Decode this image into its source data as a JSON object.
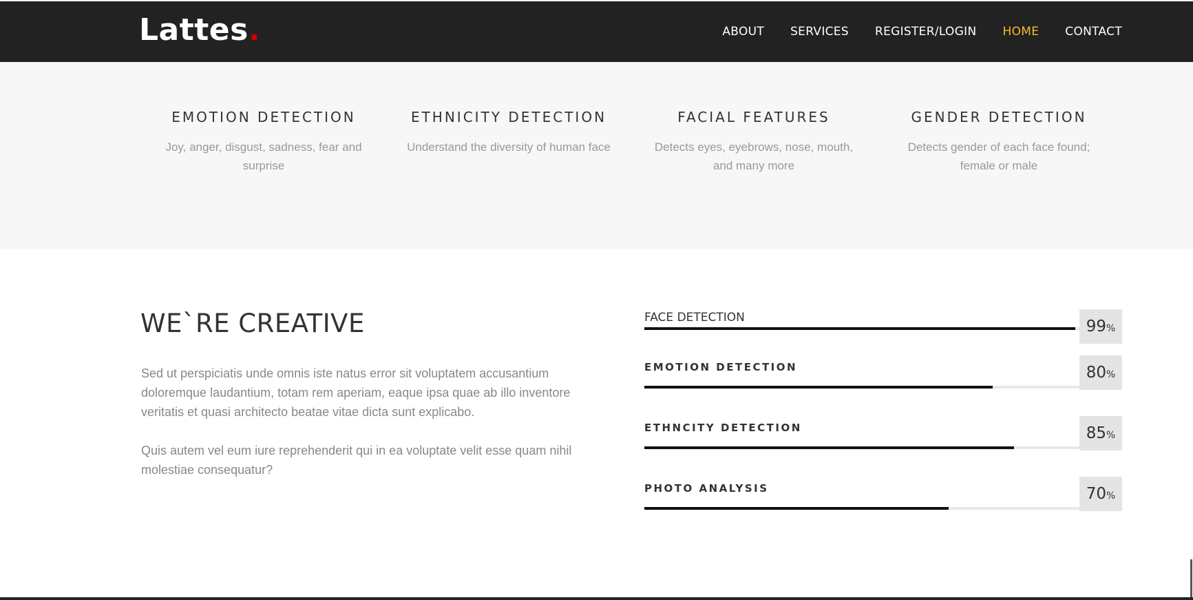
{
  "brand": {
    "name": "Lattes",
    "dot": "."
  },
  "nav": {
    "items": [
      {
        "label": "ABOUT"
      },
      {
        "label": "SERVICES"
      },
      {
        "label": "REGISTER/LOGIN"
      },
      {
        "label": "HOME",
        "active": true
      },
      {
        "label": "CONTACT"
      }
    ],
    "active_color": "#f8b933"
  },
  "features": [
    {
      "title": "EMOTION DETECTION",
      "desc": "Joy, anger, disgust, sadness, fear and surprise"
    },
    {
      "title": "ETHNICITY DETECTION",
      "desc": "Understand the diversity of human face"
    },
    {
      "title": "FACIAL FEATURES",
      "desc": "Detects eyes, eyebrows, nose, mouth, and many more"
    },
    {
      "title": "GENDER DETECTION",
      "desc": "Detects gender of each face found; female or male"
    }
  ],
  "creative": {
    "heading": "WE`RE CREATIVE",
    "paragraphs": [
      "Sed ut perspiciatis unde omnis iste natus error sit voluptatem accusantium doloremque laudantium, totam rem aperiam, eaque ipsa quae ab illo inventore veritatis et quasi architecto beatae vitae dicta sunt explicabo.",
      "Quis autem vel eum iure reprehenderit qui in ea voluptate velit esse quam nihil molestiae consequatur?"
    ]
  },
  "skills": [
    {
      "label": "FACE DETECTION",
      "percent": 99,
      "display": "99"
    },
    {
      "label": "EMOTION DETECTION",
      "percent": 80,
      "display": "80"
    },
    {
      "label": "ETHNCITY DETECTION",
      "percent": 85,
      "display": "85"
    },
    {
      "label": "PHOTO ANALYSIS",
      "percent": 70,
      "display": "70"
    }
  ],
  "percent_unit": "%"
}
